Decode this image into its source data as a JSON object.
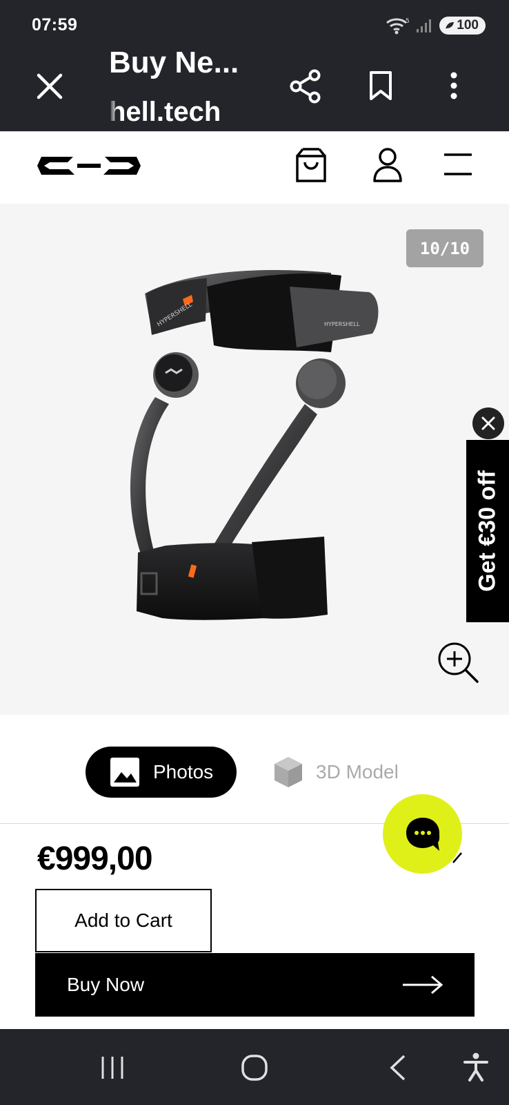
{
  "status_bar": {
    "time": "07:59",
    "battery": "100",
    "icons": [
      "wifi-icon",
      "signal-icon",
      "battery-icon"
    ]
  },
  "browser": {
    "title": "Buy Ne...",
    "url": "hell.tech",
    "icons": [
      "close-icon",
      "share-icon",
      "bookmark-icon",
      "more-vert-icon"
    ]
  },
  "site_header": {
    "icons": [
      "hypershell-logo",
      "shopping-bag-icon",
      "account-icon",
      "menu-icon"
    ]
  },
  "gallery": {
    "counter": "10/10",
    "icons": [
      "zoom-in-icon"
    ]
  },
  "promo": {
    "text": "Get €30 off"
  },
  "media_switch": {
    "photos_label": "Photos",
    "model_label": "3D Model"
  },
  "product": {
    "price": "€999,00",
    "add_to_cart": "Add to Cart",
    "buy_now": "Buy Now"
  },
  "colors": {
    "chrome_bg": "#23252b",
    "chat_accent": "#dff019",
    "counter_bg": "#a3a3a3",
    "gallery_bg": "#f5f5f5"
  }
}
